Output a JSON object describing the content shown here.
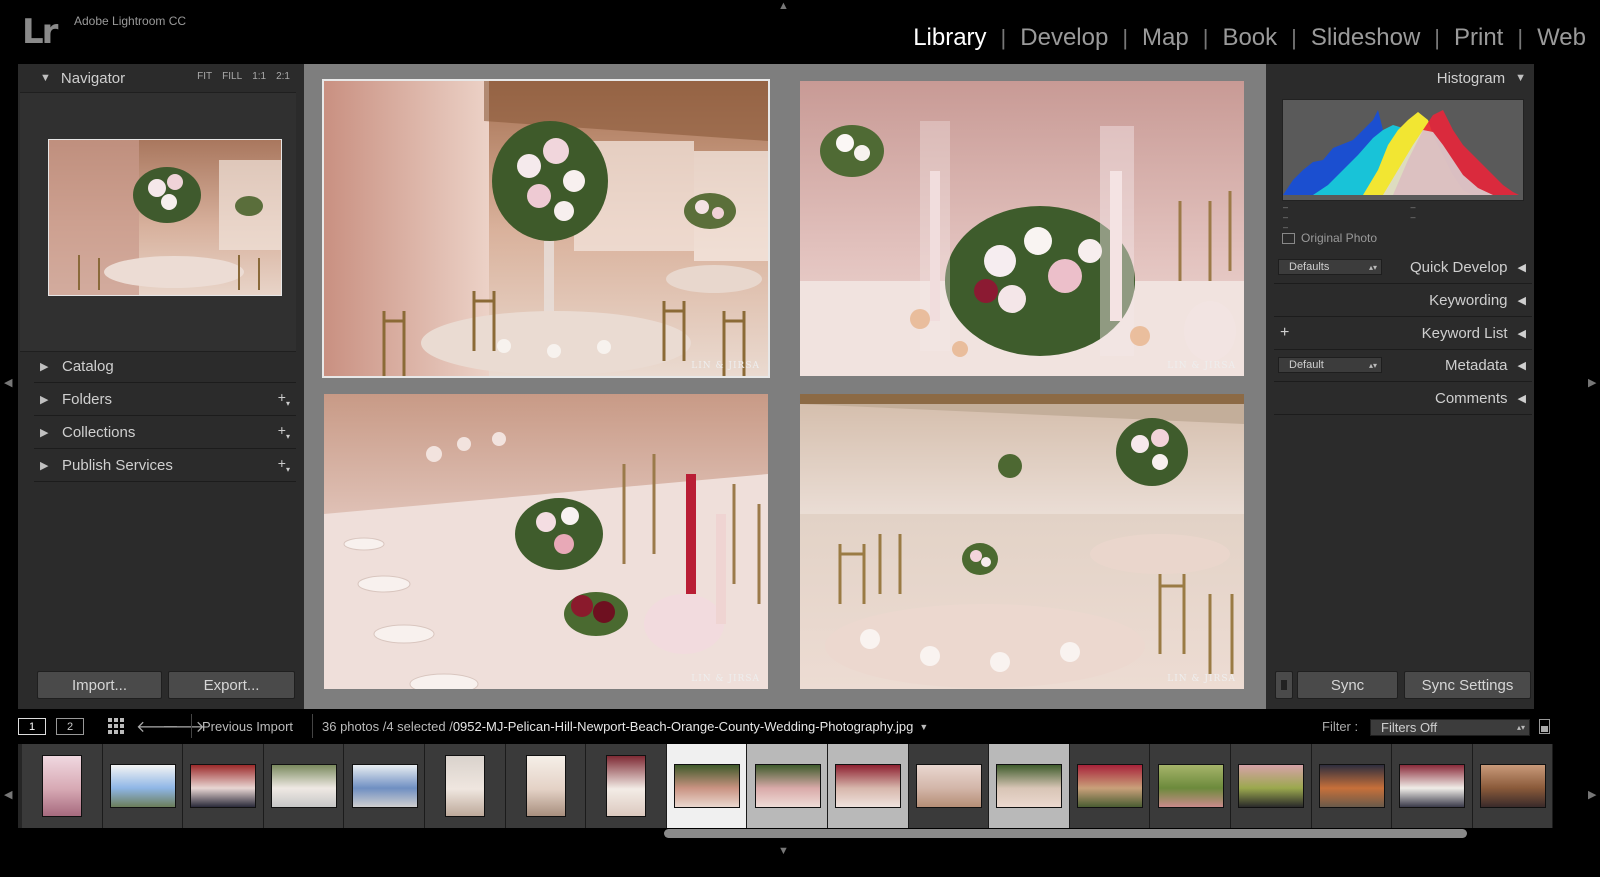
{
  "app": {
    "logo": "Lr",
    "title": "Adobe Lightroom CC"
  },
  "modules": [
    "Library",
    "Develop",
    "Map",
    "Book",
    "Slideshow",
    "Print",
    "Web"
  ],
  "active_module": "Library",
  "left_panel": {
    "navigator": {
      "title": "Navigator",
      "zoom_options": [
        "FIT",
        "FILL",
        "1:1",
        "2:1"
      ]
    },
    "sections": [
      {
        "label": "Catalog",
        "has_add": false
      },
      {
        "label": "Folders",
        "has_add": true
      },
      {
        "label": "Collections",
        "has_add": true
      },
      {
        "label": "Publish Services",
        "has_add": true
      }
    ],
    "import_label": "Import...",
    "export_label": "Export..."
  },
  "center": {
    "watermark": "LIN & JIRSA"
  },
  "right_panel": {
    "histogram": {
      "title": "Histogram",
      "original_photo_label": "Original Photo"
    },
    "quick_develop": {
      "preset": "Defaults",
      "label": "Quick Develop"
    },
    "keywording": {
      "label": "Keywording"
    },
    "keyword_list": {
      "label": "Keyword List",
      "add_symbol": "+"
    },
    "metadata": {
      "preset": "Default",
      "label": "Metadata"
    },
    "comments": {
      "label": "Comments"
    },
    "sync_label": "Sync",
    "sync_settings_label": "Sync Settings"
  },
  "filmstrip_bar": {
    "view1": "1",
    "view2": "2",
    "source": "Previous Import",
    "count": "36 photos /4 selected /",
    "filename": "0952-MJ-Pelican-Hill-Newport-Beach-Orange-County-Wedding-Photography.jpg",
    "filter_label": "Filter :",
    "filter_value": "Filters Off"
  },
  "filmstrip": {
    "total_cells": 19,
    "selected_cells": [
      8,
      9,
      10,
      12
    ],
    "active_cell": 8
  },
  "colors": {
    "accent_white": "#ffffff",
    "panel": "#2b2b2b",
    "center_bg": "#7e7e7e"
  }
}
